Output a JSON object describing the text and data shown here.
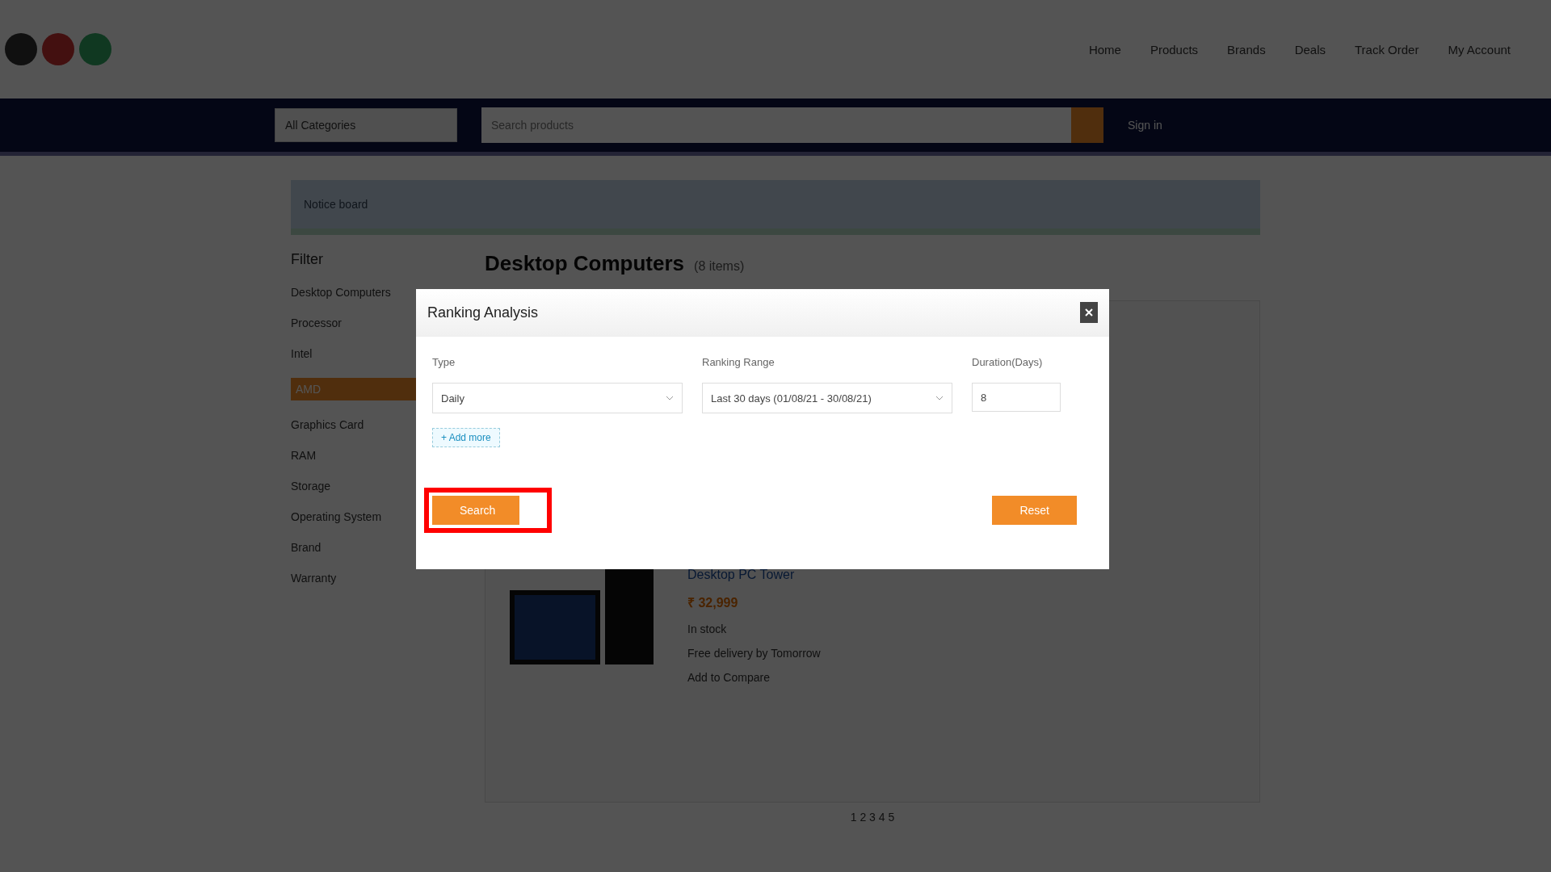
{
  "header": {
    "nav_links": [
      "Home",
      "Products",
      "Brands",
      "Deals",
      "Track Order",
      "My Account"
    ]
  },
  "search_bar": {
    "category": "All Categories",
    "placeholder": "Search products",
    "account": "Sign in"
  },
  "notice": {
    "text": "Notice board"
  },
  "sidebar": {
    "title": "Filter",
    "items": [
      {
        "label": "Desktop Computers",
        "selected": false
      },
      {
        "label": "Processor",
        "selected": false
      },
      {
        "label": "Intel",
        "selected": false
      },
      {
        "label": "AMD",
        "selected": true
      },
      {
        "label": "Graphics Card",
        "selected": false
      },
      {
        "label": "RAM",
        "selected": false
      },
      {
        "label": "Storage",
        "selected": false
      },
      {
        "label": "Operating System",
        "selected": false
      },
      {
        "label": "Brand",
        "selected": false
      },
      {
        "label": "Warranty",
        "selected": false
      }
    ]
  },
  "page": {
    "title": "Desktop Computers",
    "count": "(8 items)"
  },
  "product": {
    "name": "Desktop PC Tower",
    "price": "₹ 32,999",
    "details": [
      "In stock",
      "Free delivery by Tomorrow",
      "Add to Compare"
    ]
  },
  "modal": {
    "title": "Ranking Analysis",
    "fields": [
      {
        "kind": "select",
        "label": "Type",
        "value": "Daily"
      },
      {
        "kind": "select",
        "label": "Ranking Range",
        "value": "Last 30 days (01/08/21 - 30/08/21)"
      },
      {
        "kind": "input",
        "label": "Duration(Days)",
        "value": "8"
      }
    ],
    "add_chip": "+ Add more",
    "buttons": [
      {
        "label": "Search",
        "highlighted": true
      },
      {
        "label": "Reset",
        "highlighted": false
      }
    ]
  },
  "pagination": "1 2 3 4 5"
}
